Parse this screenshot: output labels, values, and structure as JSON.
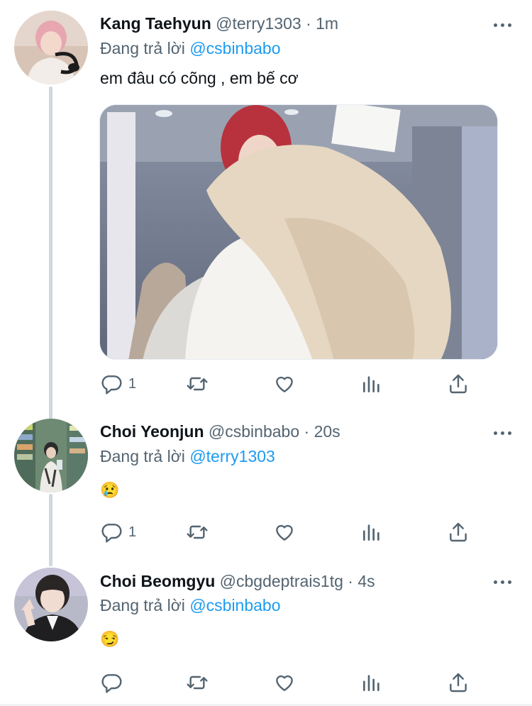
{
  "tweets": [
    {
      "name": "Kang Taehyun",
      "handle": "@terry1303",
      "dot": "·",
      "time": "1m",
      "reply_prefix": "Đang trả lời",
      "reply_mention": "@csbinbabo",
      "text": "em đâu có cõng , em bế cơ",
      "reply_count": "1",
      "has_media": true
    },
    {
      "name": "Choi Yeonjun",
      "handle": "@csbinbabo",
      "dot": "·",
      "time": "20s",
      "reply_prefix": "Đang trả lời",
      "reply_mention": "@terry1303",
      "text": "😢",
      "reply_count": "1",
      "has_media": false
    },
    {
      "name": "Choi Beomgyu",
      "handle": "@cbgdeptrais1tg",
      "dot": "·",
      "time": "4s",
      "reply_prefix": "Đang trả lời",
      "reply_mention": "@csbinbabo",
      "text": "😏",
      "reply_count": "",
      "has_media": false
    }
  ],
  "colors": {
    "link": "#1d9bf0",
    "secondary_text": "#536471",
    "thread_line": "#cfd9de"
  },
  "icons": [
    "reply-icon",
    "retweet-icon",
    "like-icon",
    "views-icon",
    "share-icon",
    "more-icon"
  ]
}
